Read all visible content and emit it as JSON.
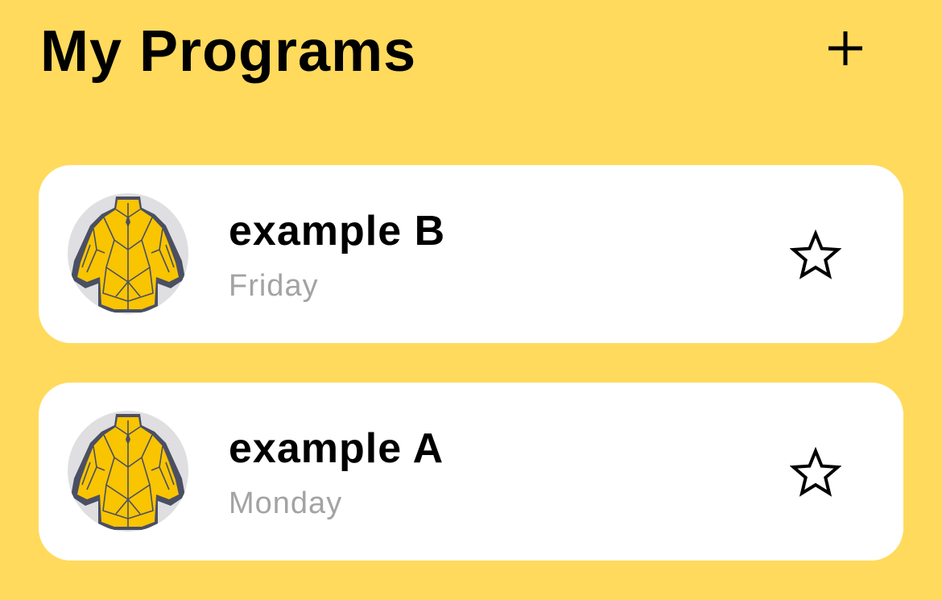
{
  "header": {
    "title": "My Programs",
    "add_icon": "plus-icon"
  },
  "programs": [
    {
      "name": "example B",
      "day": "Friday",
      "icon": "muscle-back-icon",
      "favorite_icon": "star-outline-icon",
      "favorited": false
    },
    {
      "name": "example A",
      "day": "Monday",
      "icon": "muscle-back-icon",
      "favorite_icon": "star-outline-icon",
      "favorited": false
    }
  ],
  "colors": {
    "background": "#FFDA5C",
    "card": "#FFFFFF",
    "title_text": "#000000",
    "subtitle_text": "#A3A3A3",
    "muscle_fill": "#F9C400",
    "muscle_outline": "#4A4F63",
    "avatar_bg": "#DFDFE1"
  }
}
